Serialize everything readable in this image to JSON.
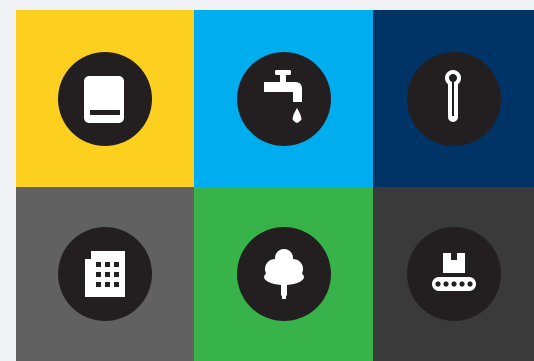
{
  "tiles": [
    {
      "icon": "book-icon",
      "background": "#fdd020"
    },
    {
      "icon": "water-tap-icon",
      "background": "#00aeef"
    },
    {
      "icon": "thermometer-icon",
      "background": "#003366"
    },
    {
      "icon": "office-building-icon",
      "background": "#616161"
    },
    {
      "icon": "tree-icon",
      "background": "#37b34a"
    },
    {
      "icon": "conveyor-box-icon",
      "background": "#3a3a3a"
    }
  ],
  "colors": {
    "icon_circle": "#231f20",
    "icon_glyph": "#ffffff",
    "page_background": "#f0f2f5"
  }
}
